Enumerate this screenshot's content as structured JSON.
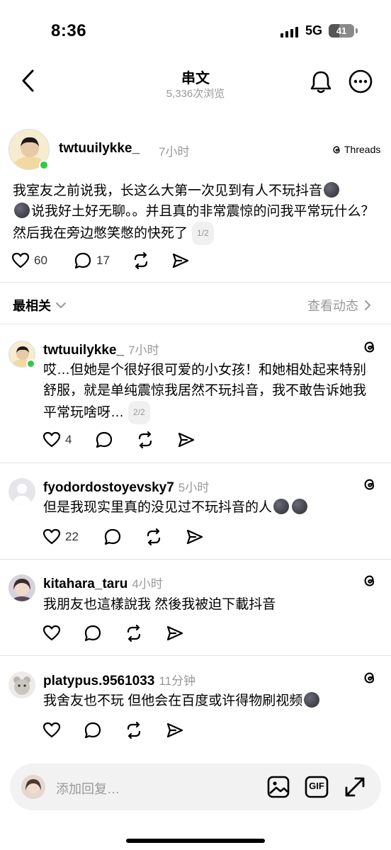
{
  "status": {
    "time": "8:36",
    "network": "5G",
    "battery": "41",
    "battery_level": 0.41
  },
  "nav": {
    "title": "串文",
    "views": "5,336次浏览",
    "back_icon": "chevron-left-icon",
    "bell_icon": "bell-icon",
    "more_icon": "more-icon"
  },
  "post": {
    "username": "twtuuilykke_",
    "time": "7小时",
    "source": "Threads",
    "text_1": "我室友之前说我，长这么大第一次见到有人不玩抖音",
    "text_2": "说我好土好无聊。。并且真的非常震惊的问我平常玩什么？然后我在旁边憋笑憋的快死了",
    "page": "1/2",
    "likes": "60",
    "comments": "17"
  },
  "sort": {
    "label": "最相关",
    "activity": "查看动态"
  },
  "replies": [
    {
      "username": "twtuuilykke_",
      "time": "7小时",
      "text": "哎…但她是个很好很可爱的小女孩！和她相处起来特别舒服，就是单纯震惊我居然不玩抖音，我不敢告诉她我平常玩啥呀…",
      "page": "2/2",
      "likes": "4",
      "comments": ""
    },
    {
      "username": "fyodordostoyevsky7",
      "time": "5小时",
      "text": "但是我现实里真的没见过不玩抖音的人",
      "likes": "22",
      "comments": ""
    },
    {
      "username": "kitahara_taru",
      "time": "4小时",
      "text": "我朋友也這樣說我 然後我被迫下載抖音",
      "likes": "",
      "comments": ""
    },
    {
      "username": "platypus.9561033",
      "time": "11分钟",
      "text": "我舍友也不玩 但他会在百度或许得物刷视频",
      "likes": "",
      "comments": ""
    }
  ],
  "composer": {
    "placeholder": "添加回复…",
    "gif_label": "GIF"
  },
  "colors": {
    "accent_online": "#2ecc40",
    "muted_text": "#999999",
    "emoji_dark": "#2b2b33"
  }
}
